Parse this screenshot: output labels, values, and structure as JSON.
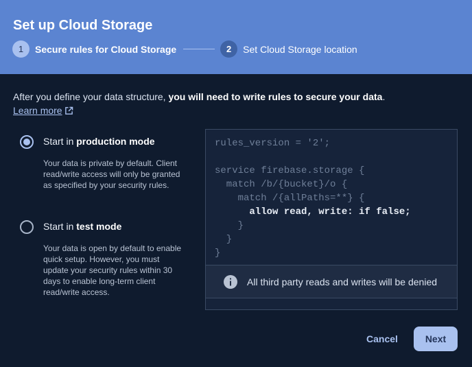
{
  "dialog": {
    "title": "Set up Cloud Storage"
  },
  "stepper": {
    "steps": [
      {
        "number": "1",
        "label": "Secure rules for Cloud Storage",
        "state": "active"
      },
      {
        "number": "2",
        "label": "Set Cloud Storage location",
        "state": "upcoming"
      }
    ]
  },
  "intro": {
    "text_plain": "After you define your data structure, ",
    "text_bold": "you will need to write rules to secure your data",
    "text_end": ".",
    "learn_more": "Learn more"
  },
  "options": [
    {
      "prefix": "Start in ",
      "bold": "production mode",
      "selected": true,
      "description": "Your data is private by default. Client read/write access will only be granted as specified by your security rules."
    },
    {
      "prefix": "Start in ",
      "bold": "test mode",
      "selected": false,
      "description": "Your data is open by default to enable quick setup. However, you must update your security rules within 30 days to enable long-term client read/write access."
    }
  ],
  "code": {
    "line1": "rules_version = '2';",
    "line2": "",
    "line3": "service firebase.storage {",
    "line4": "  match /b/{bucket}/o {",
    "line5": "    match /{allPaths=**} {",
    "line6": "      allow read, write: if false;",
    "line7": "    }",
    "line8": "  }",
    "line9": "}"
  },
  "notice": {
    "text": "All third party reads and writes will be denied",
    "icon": "info-icon"
  },
  "buttons": {
    "cancel": "Cancel",
    "next": "Next"
  },
  "colors": {
    "header_bg": "#5b84d1",
    "body_bg": "#0f1b2e",
    "accent": "#a9c1ef"
  }
}
